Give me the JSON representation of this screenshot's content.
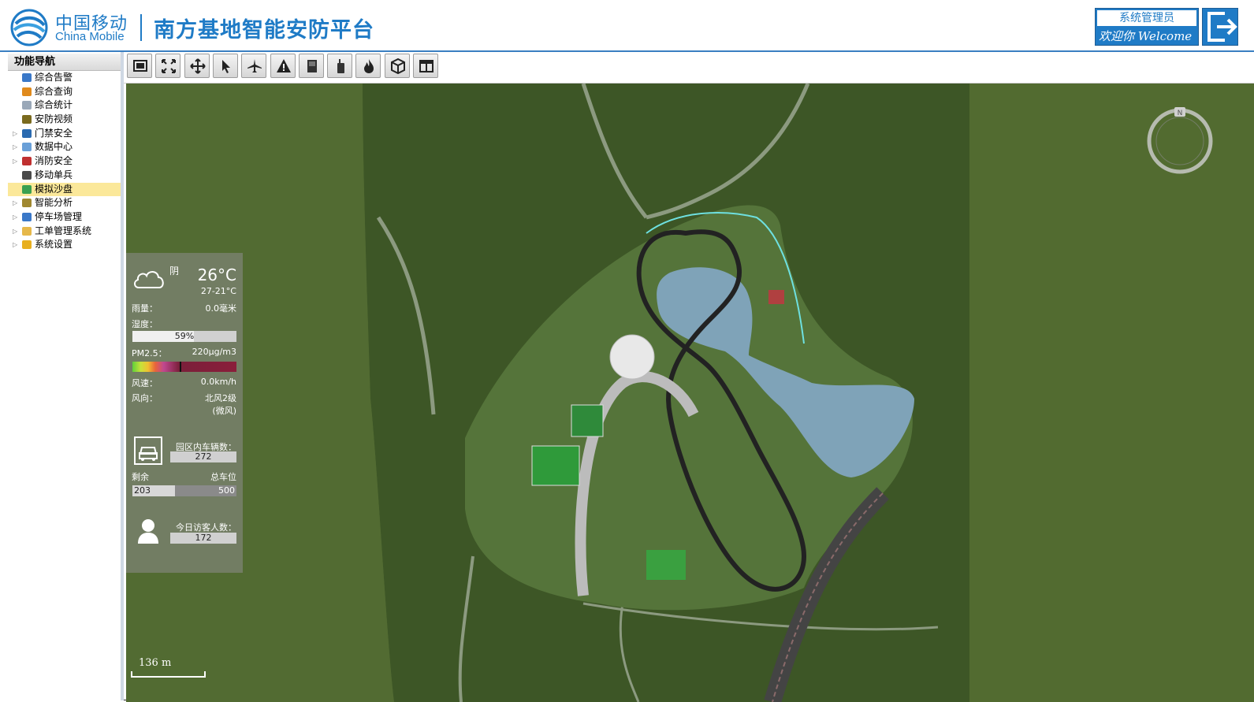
{
  "header": {
    "logo_cn": "中国移动",
    "logo_en": "China Mobile",
    "app_title": "南方基地智能安防平台",
    "user_role": "系统管理员",
    "welcome": "欢迎你 Welcome"
  },
  "nav": {
    "title": "功能导航",
    "items": [
      {
        "label": "综合告警",
        "icon": "alarm-icon",
        "expandable": false,
        "color": "#3a78c8"
      },
      {
        "label": "综合查询",
        "icon": "query-icon",
        "expandable": false,
        "color": "#e08a1c"
      },
      {
        "label": "综合统计",
        "icon": "chart-icon",
        "expandable": false,
        "color": "#9aa8b8"
      },
      {
        "label": "安防视频",
        "icon": "video-icon",
        "expandable": false,
        "color": "#7a6a1e"
      },
      {
        "label": "门禁安全",
        "icon": "door-icon",
        "expandable": true,
        "color": "#2a6ab0"
      },
      {
        "label": "数据中心",
        "icon": "database-icon",
        "expandable": true,
        "color": "#6aa0d8"
      },
      {
        "label": "消防安全",
        "icon": "firetruck-icon",
        "expandable": true,
        "color": "#c03030"
      },
      {
        "label": "移动单兵",
        "icon": "soldier-icon",
        "expandable": false,
        "color": "#4a4a4a"
      },
      {
        "label": "模拟沙盘",
        "icon": "cube-icon",
        "expandable": false,
        "color": "#3aa050",
        "active": true
      },
      {
        "label": "智能分析",
        "icon": "analysis-icon",
        "expandable": true,
        "color": "#a08830"
      },
      {
        "label": "停车场管理",
        "icon": "car-icon",
        "expandable": true,
        "color": "#3a78c8"
      },
      {
        "label": "工单管理系统",
        "icon": "folder-icon",
        "expandable": true,
        "color": "#e6b84a"
      },
      {
        "label": "系统设置",
        "icon": "gear-icon",
        "expandable": true,
        "color": "#e8b020"
      }
    ]
  },
  "toolbar": [
    {
      "icon": "fullscreen-icon"
    },
    {
      "icon": "expand-icon"
    },
    {
      "icon": "pan-icon"
    },
    {
      "icon": "pointer-icon"
    },
    {
      "icon": "airplane-icon"
    },
    {
      "icon": "warning-icon"
    },
    {
      "icon": "door-icon"
    },
    {
      "icon": "radio-icon"
    },
    {
      "icon": "fire-icon"
    },
    {
      "icon": "cube-icon"
    },
    {
      "icon": "layout-icon"
    }
  ],
  "weather": {
    "condition": "阴",
    "temp": "26°C",
    "range": "27-21°C",
    "rain_label": "雨量：",
    "rain_value": "0.0毫米",
    "humidity_label": "湿度：",
    "humidity_value": "59%",
    "humidity_pct": 59,
    "pm_label": "PM2.5：",
    "pm_value": "220μg/m3",
    "wind_speed_label": "风速：",
    "wind_speed_value": "0.0km/h",
    "wind_dir_label": "风向：",
    "wind_dir_value": "北风2级",
    "wind_dir_note": "(微风)"
  },
  "parking": {
    "vehicles_label": "园区内车辆数：",
    "vehicles_value": "272",
    "remaining_label": "剩余",
    "total_label": "总车位",
    "remaining_value": "203",
    "total_value": "500",
    "remaining_pct": 40.6
  },
  "visitors": {
    "label": "今日访客人数：",
    "value": "172"
  },
  "map": {
    "scale_label": "136  m",
    "compass_label": "N"
  },
  "colors": {
    "brand": "#1f7bc6",
    "grass_dark": "#3f5728",
    "grass_light": "#526b30",
    "lake": "#7fa3b8",
    "road": "#8a8a8a"
  }
}
